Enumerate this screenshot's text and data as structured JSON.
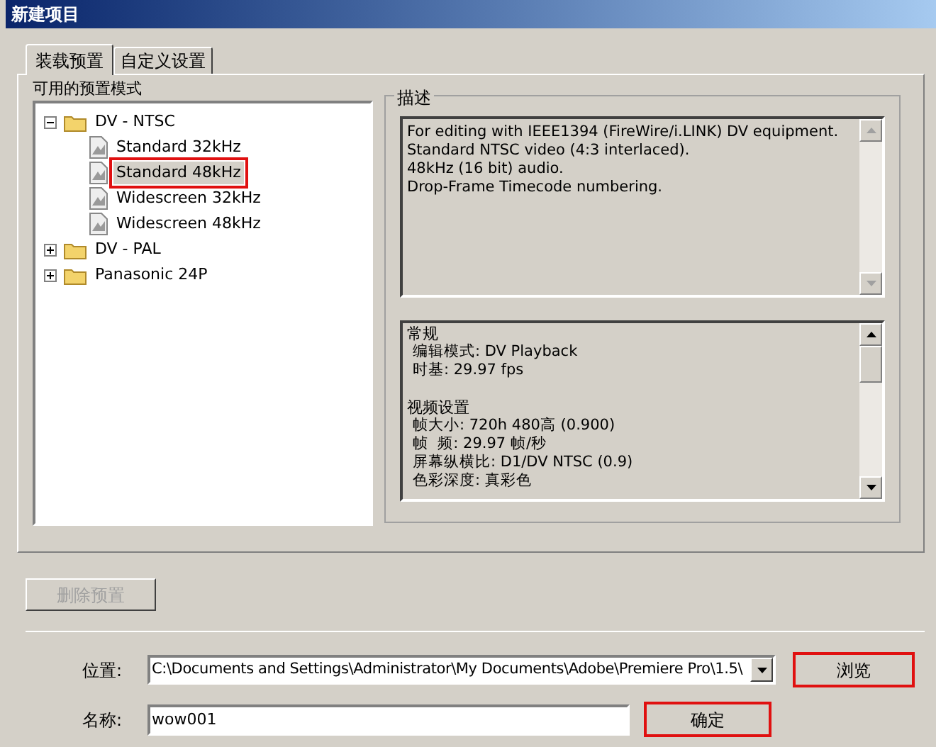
{
  "window": {
    "title": "新建项目"
  },
  "tabs": [
    {
      "label": "装载预置",
      "selected": true
    },
    {
      "label": "自定义设置",
      "selected": false
    }
  ],
  "presets": {
    "label": "可用的预置模式",
    "tree": [
      {
        "label": "DV - NTSC",
        "kind": "folder",
        "expanded": true,
        "children": [
          {
            "label": "Standard 32kHz",
            "kind": "preset",
            "selected": false,
            "annotated": false
          },
          {
            "label": "Standard 48kHz",
            "kind": "preset",
            "selected": true,
            "annotated": true
          },
          {
            "label": "Widescreen 32kHz",
            "kind": "preset",
            "selected": false,
            "annotated": false
          },
          {
            "label": "Widescreen 48kHz",
            "kind": "preset",
            "selected": false,
            "annotated": false
          }
        ]
      },
      {
        "label": "DV - PAL",
        "kind": "folder",
        "expanded": false
      },
      {
        "label": "Panasonic 24P",
        "kind": "folder",
        "expanded": false
      }
    ]
  },
  "description": {
    "title": "描述",
    "summary": [
      "For editing with IEEE1394 (FireWire/i.LINK) DV equipment.",
      "Standard NTSC video (4:3 interlaced).",
      "48kHz (16 bit) audio.",
      "Drop-Frame Timecode numbering."
    ],
    "sections": [
      {
        "heading": "常规",
        "items": [
          "编辑模式: DV Playback",
          "时基: 29.97 fps"
        ]
      },
      {
        "heading": "视频设置",
        "items": [
          "帧大小: 720h 480高 (0.900)",
          "帧  频: 29.97 帧/秒",
          "屏幕纵横比: D1/DV NTSC (0.9)",
          "色彩深度: 真彩色"
        ]
      }
    ]
  },
  "delete_button": {
    "label": "删除预置",
    "disabled": true
  },
  "location": {
    "label": "位置:",
    "value": "C:\\Documents and Settings\\Administrator\\My Documents\\Adobe\\Premiere Pro\\1.5\\"
  },
  "browse_button": {
    "label": "浏览",
    "annotated": true
  },
  "name": {
    "label": "名称:",
    "value": "wow001"
  },
  "ok_button": {
    "label": "确定",
    "annotated": true
  }
}
